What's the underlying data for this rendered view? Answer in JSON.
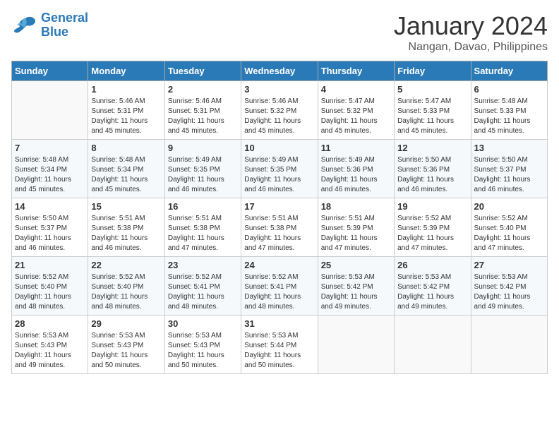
{
  "logo": {
    "line1": "General",
    "line2": "Blue"
  },
  "title": "January 2024",
  "location": "Nangan, Davao, Philippines",
  "days_of_week": [
    "Sunday",
    "Monday",
    "Tuesday",
    "Wednesday",
    "Thursday",
    "Friday",
    "Saturday"
  ],
  "weeks": [
    [
      {
        "day": "",
        "info": ""
      },
      {
        "day": "1",
        "info": "Sunrise: 5:46 AM\nSunset: 5:31 PM\nDaylight: 11 hours\nand 45 minutes."
      },
      {
        "day": "2",
        "info": "Sunrise: 5:46 AM\nSunset: 5:31 PM\nDaylight: 11 hours\nand 45 minutes."
      },
      {
        "day": "3",
        "info": "Sunrise: 5:46 AM\nSunset: 5:32 PM\nDaylight: 11 hours\nand 45 minutes."
      },
      {
        "day": "4",
        "info": "Sunrise: 5:47 AM\nSunset: 5:32 PM\nDaylight: 11 hours\nand 45 minutes."
      },
      {
        "day": "5",
        "info": "Sunrise: 5:47 AM\nSunset: 5:33 PM\nDaylight: 11 hours\nand 45 minutes."
      },
      {
        "day": "6",
        "info": "Sunrise: 5:48 AM\nSunset: 5:33 PM\nDaylight: 11 hours\nand 45 minutes."
      }
    ],
    [
      {
        "day": "7",
        "info": "Sunrise: 5:48 AM\nSunset: 5:34 PM\nDaylight: 11 hours\nand 45 minutes."
      },
      {
        "day": "8",
        "info": "Sunrise: 5:48 AM\nSunset: 5:34 PM\nDaylight: 11 hours\nand 45 minutes."
      },
      {
        "day": "9",
        "info": "Sunrise: 5:49 AM\nSunset: 5:35 PM\nDaylight: 11 hours\nand 46 minutes."
      },
      {
        "day": "10",
        "info": "Sunrise: 5:49 AM\nSunset: 5:35 PM\nDaylight: 11 hours\nand 46 minutes."
      },
      {
        "day": "11",
        "info": "Sunrise: 5:49 AM\nSunset: 5:36 PM\nDaylight: 11 hours\nand 46 minutes."
      },
      {
        "day": "12",
        "info": "Sunrise: 5:50 AM\nSunset: 5:36 PM\nDaylight: 11 hours\nand 46 minutes."
      },
      {
        "day": "13",
        "info": "Sunrise: 5:50 AM\nSunset: 5:37 PM\nDaylight: 11 hours\nand 46 minutes."
      }
    ],
    [
      {
        "day": "14",
        "info": "Sunrise: 5:50 AM\nSunset: 5:37 PM\nDaylight: 11 hours\nand 46 minutes."
      },
      {
        "day": "15",
        "info": "Sunrise: 5:51 AM\nSunset: 5:38 PM\nDaylight: 11 hours\nand 46 minutes."
      },
      {
        "day": "16",
        "info": "Sunrise: 5:51 AM\nSunset: 5:38 PM\nDaylight: 11 hours\nand 47 minutes."
      },
      {
        "day": "17",
        "info": "Sunrise: 5:51 AM\nSunset: 5:38 PM\nDaylight: 11 hours\nand 47 minutes."
      },
      {
        "day": "18",
        "info": "Sunrise: 5:51 AM\nSunset: 5:39 PM\nDaylight: 11 hours\nand 47 minutes."
      },
      {
        "day": "19",
        "info": "Sunrise: 5:52 AM\nSunset: 5:39 PM\nDaylight: 11 hours\nand 47 minutes."
      },
      {
        "day": "20",
        "info": "Sunrise: 5:52 AM\nSunset: 5:40 PM\nDaylight: 11 hours\nand 47 minutes."
      }
    ],
    [
      {
        "day": "21",
        "info": "Sunrise: 5:52 AM\nSunset: 5:40 PM\nDaylight: 11 hours\nand 48 minutes."
      },
      {
        "day": "22",
        "info": "Sunrise: 5:52 AM\nSunset: 5:40 PM\nDaylight: 11 hours\nand 48 minutes."
      },
      {
        "day": "23",
        "info": "Sunrise: 5:52 AM\nSunset: 5:41 PM\nDaylight: 11 hours\nand 48 minutes."
      },
      {
        "day": "24",
        "info": "Sunrise: 5:52 AM\nSunset: 5:41 PM\nDaylight: 11 hours\nand 48 minutes."
      },
      {
        "day": "25",
        "info": "Sunrise: 5:53 AM\nSunset: 5:42 PM\nDaylight: 11 hours\nand 49 minutes."
      },
      {
        "day": "26",
        "info": "Sunrise: 5:53 AM\nSunset: 5:42 PM\nDaylight: 11 hours\nand 49 minutes."
      },
      {
        "day": "27",
        "info": "Sunrise: 5:53 AM\nSunset: 5:42 PM\nDaylight: 11 hours\nand 49 minutes."
      }
    ],
    [
      {
        "day": "28",
        "info": "Sunrise: 5:53 AM\nSunset: 5:43 PM\nDaylight: 11 hours\nand 49 minutes."
      },
      {
        "day": "29",
        "info": "Sunrise: 5:53 AM\nSunset: 5:43 PM\nDaylight: 11 hours\nand 50 minutes."
      },
      {
        "day": "30",
        "info": "Sunrise: 5:53 AM\nSunset: 5:43 PM\nDaylight: 11 hours\nand 50 minutes."
      },
      {
        "day": "31",
        "info": "Sunrise: 5:53 AM\nSunset: 5:44 PM\nDaylight: 11 hours\nand 50 minutes."
      },
      {
        "day": "",
        "info": ""
      },
      {
        "day": "",
        "info": ""
      },
      {
        "day": "",
        "info": ""
      }
    ]
  ]
}
